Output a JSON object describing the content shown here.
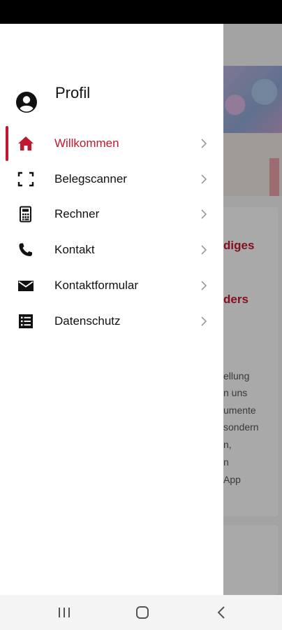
{
  "drawer": {
    "profile_label": "Profil",
    "items": [
      {
        "label": "Willkommen",
        "icon": "home-icon",
        "active": true
      },
      {
        "label": "Belegscanner",
        "icon": "scan-icon",
        "active": false
      },
      {
        "label": "Rechner",
        "icon": "calculator-icon",
        "active": false
      },
      {
        "label": "Kontakt",
        "icon": "phone-icon",
        "active": false
      },
      {
        "label": "Kontaktformular",
        "icon": "mail-icon",
        "active": false
      },
      {
        "label": "Datenschutz",
        "icon": "list-icon",
        "active": false
      }
    ]
  },
  "background": {
    "heading_1": "diges",
    "heading_2": "ders",
    "lines": [
      "ellung",
      "n uns",
      "umente",
      "sondern",
      "n,",
      "n",
      "App"
    ]
  },
  "colors": {
    "accent": "#c2182f",
    "text": "#111111"
  }
}
